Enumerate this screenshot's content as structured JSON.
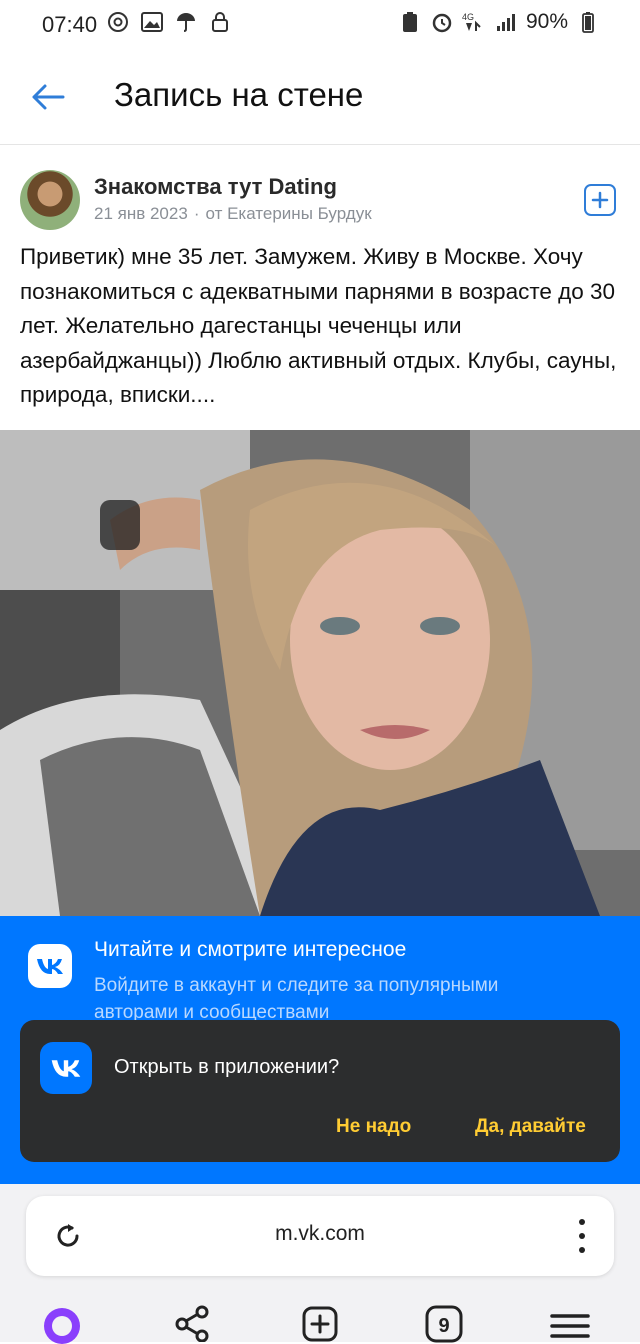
{
  "status": {
    "time": "07:40",
    "battery": "90%",
    "network": "4G"
  },
  "header": {
    "title": "Запись на стене"
  },
  "post": {
    "author": "Знакомства тут Dating",
    "date": "21 янв 2023",
    "separator": "·",
    "from": "от Екатерины Бурдук",
    "text": "Приветик) мне 35 лет. Замужем. Живу в Москве. Хочу познакомиться с адекватными парнями в возрасте до 30 лет. Желательно дагестанцы чеченцы или азербайджанцы)) Люблю активный отдых. Клубы, сауны, природа, вписки...."
  },
  "banner": {
    "title": "Читайте и смотрите интересное",
    "subtitle": "Войдите в аккаунт и следите за популярными авторами и сообществами"
  },
  "dialog": {
    "text": "Открыть в приложении?",
    "no": "Не надо",
    "yes": "Да, давайте"
  },
  "browser": {
    "url": "m.vk.com",
    "tabs_count": "9"
  },
  "colors": {
    "accent": "#0077ff",
    "dialog_bg": "#2c2d2e",
    "dialog_button": "#ffcc33",
    "link_blue": "#2f7dd8"
  }
}
